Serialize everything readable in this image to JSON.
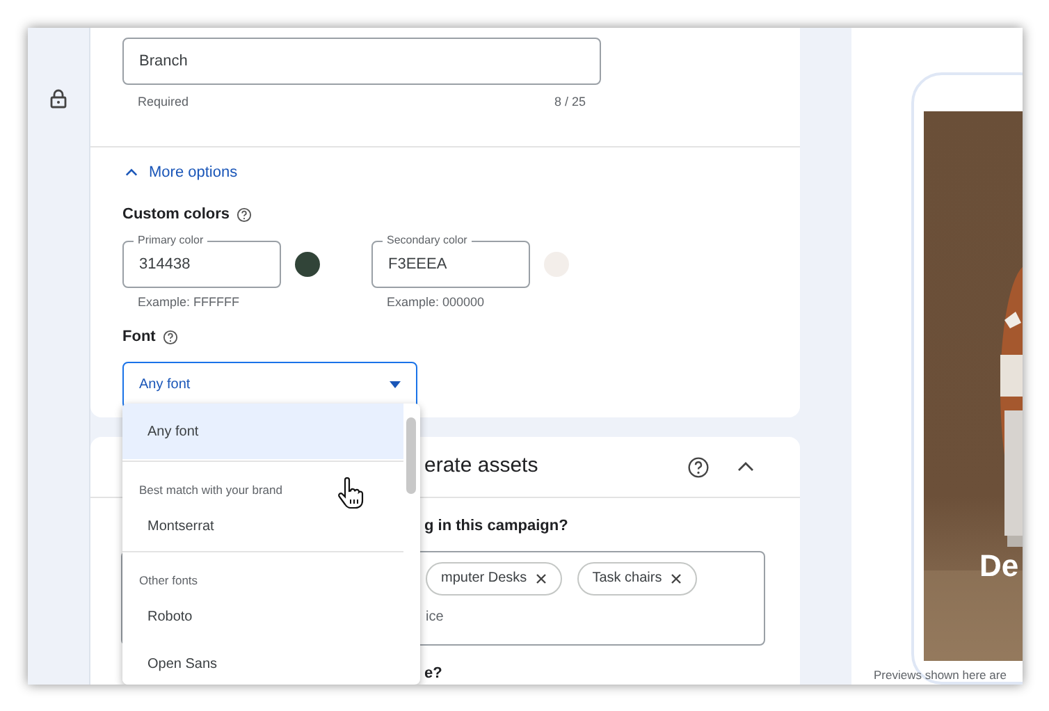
{
  "business_name_field": {
    "value": "Branch",
    "helper": "Required",
    "counter": "8 / 25"
  },
  "more_options": {
    "label": "More options",
    "expanded": true
  },
  "custom_colors": {
    "label": "Custom colors",
    "fields": [
      {
        "label": "Primary color",
        "value": "314438",
        "example": "Example: FFFFFF",
        "color": "#314438"
      },
      {
        "label": "Secondary color",
        "value": "F3EEEA",
        "example": "Example: 000000",
        "color": "#f3eeea"
      }
    ]
  },
  "font": {
    "label": "Font",
    "value": "Any font",
    "open": true,
    "options": [
      {
        "kind": "option",
        "label": "Any font",
        "selected": true
      },
      {
        "kind": "header",
        "label": "Best match with your brand"
      },
      {
        "kind": "option",
        "label": "Montserrat",
        "selected": false
      },
      {
        "kind": "header",
        "label": "Other fonts"
      },
      {
        "kind": "option",
        "label": "Roboto",
        "selected": false
      },
      {
        "kind": "option",
        "label": "Open Sans",
        "selected": false
      }
    ]
  },
  "assets_card": {
    "title": "erate assets",
    "expanded": true,
    "question": "g in this campaign?",
    "chips": [
      {
        "label": "mputer Desks"
      },
      {
        "label": "Task chairs"
      }
    ],
    "input_text": "ice",
    "next_question": "e?"
  },
  "preview": {
    "headline": "De",
    "note": "Previews shown here are"
  }
}
